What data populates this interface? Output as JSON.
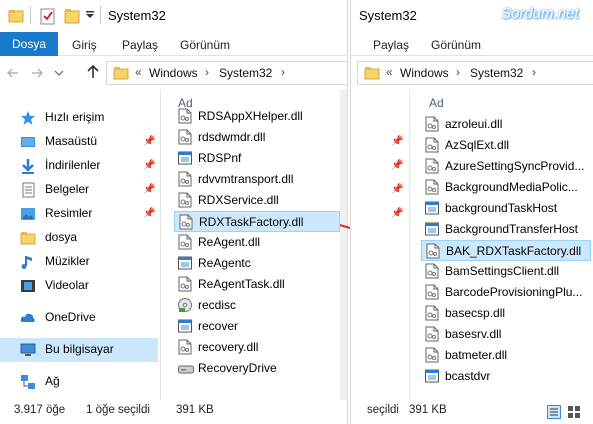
{
  "left": {
    "title": "System32",
    "tabs": [
      "Dosya",
      "Giriş",
      "Paylaş",
      "Görünüm"
    ],
    "address": {
      "prefix": "«",
      "crumbs": [
        "Windows",
        "System32"
      ]
    },
    "nav_items": [
      {
        "label": "Hızlı erişim",
        "icon": "star-icon",
        "pinned": false
      },
      {
        "label": "Masaüstü",
        "icon": "desktop-icon",
        "pinned": true
      },
      {
        "label": "İndirilenler",
        "icon": "download-icon",
        "pinned": true
      },
      {
        "label": "Belgeler",
        "icon": "documents-icon",
        "pinned": true
      },
      {
        "label": "Resimler",
        "icon": "pictures-icon",
        "pinned": true
      },
      {
        "label": "dosya",
        "icon": "folder-icon",
        "pinned": false
      },
      {
        "label": "Müzikler",
        "icon": "music-icon",
        "pinned": false
      },
      {
        "label": "Videolar",
        "icon": "video-icon",
        "pinned": false
      },
      {
        "label": "OneDrive",
        "icon": "cloud-icon",
        "pinned": false
      },
      {
        "label": "Bu bilgisayar",
        "icon": "computer-icon",
        "pinned": false,
        "selected": true
      },
      {
        "label": "Ağ",
        "icon": "network-icon",
        "pinned": false
      }
    ],
    "column_header": "Ad",
    "files": [
      {
        "name": "RDSAppXHelper.dll",
        "icon": "dll-icon"
      },
      {
        "name": "rdsdwmdr.dll",
        "icon": "dll-icon"
      },
      {
        "name": "RDSPnf",
        "icon": "app-icon"
      },
      {
        "name": "rdvvmtransport.dll",
        "icon": "dll-icon"
      },
      {
        "name": "RDXService.dll",
        "icon": "dll-icon"
      },
      {
        "name": "RDXTaskFactory.dll",
        "icon": "dll-icon",
        "selected": true
      },
      {
        "name": "ReAgent.dll",
        "icon": "dll-icon"
      },
      {
        "name": "ReAgentc",
        "icon": "app-icon"
      },
      {
        "name": "ReAgentTask.dll",
        "icon": "dll-icon"
      },
      {
        "name": "recdisc",
        "icon": "disc-icon"
      },
      {
        "name": "recover",
        "icon": "app-icon"
      },
      {
        "name": "recovery.dll",
        "icon": "dll-icon"
      },
      {
        "name": "RecoveryDrive",
        "icon": "drive-icon"
      }
    ],
    "status": {
      "count": "3.917 öğe",
      "selected": "1 öğe seçildi",
      "size": "391 KB"
    }
  },
  "right": {
    "title": "System32",
    "watermark": "Sordum.net",
    "tabs": [
      "Paylaş",
      "Görünüm"
    ],
    "address": {
      "prefix": "«",
      "crumbs": [
        "Windows",
        "System32"
      ]
    },
    "column_header": "Ad",
    "files": [
      {
        "name": "azroleui.dll",
        "icon": "dll-icon"
      },
      {
        "name": "AzSqlExt.dll",
        "icon": "dll-icon"
      },
      {
        "name": "AzureSettingSyncProvid...",
        "icon": "dll-icon"
      },
      {
        "name": "BackgroundMediaPolic...",
        "icon": "dll-icon"
      },
      {
        "name": "backgroundTaskHost",
        "icon": "app-icon"
      },
      {
        "name": "BackgroundTransferHost",
        "icon": "app-icon"
      },
      {
        "name": "BAK_RDXTaskFactory.dll",
        "icon": "dll-icon",
        "selected": true
      },
      {
        "name": "BamSettingsClient.dll",
        "icon": "dll-icon"
      },
      {
        "name": "BarcodeProvisioningPlu...",
        "icon": "dll-icon"
      },
      {
        "name": "basecsp.dll",
        "icon": "dll-icon"
      },
      {
        "name": "basesrv.dll",
        "icon": "dll-icon"
      },
      {
        "name": "batmeter.dll",
        "icon": "dll-icon"
      },
      {
        "name": "bcastdvr",
        "icon": "app-icon"
      }
    ],
    "status": {
      "selected": "seçildi",
      "size": "391 KB"
    }
  },
  "colors": {
    "accent": "#1979ca",
    "selection": "#cce8ff",
    "selection_border": "#99d1ff",
    "arrow": "#e03030",
    "watermark": "#ffffff"
  }
}
